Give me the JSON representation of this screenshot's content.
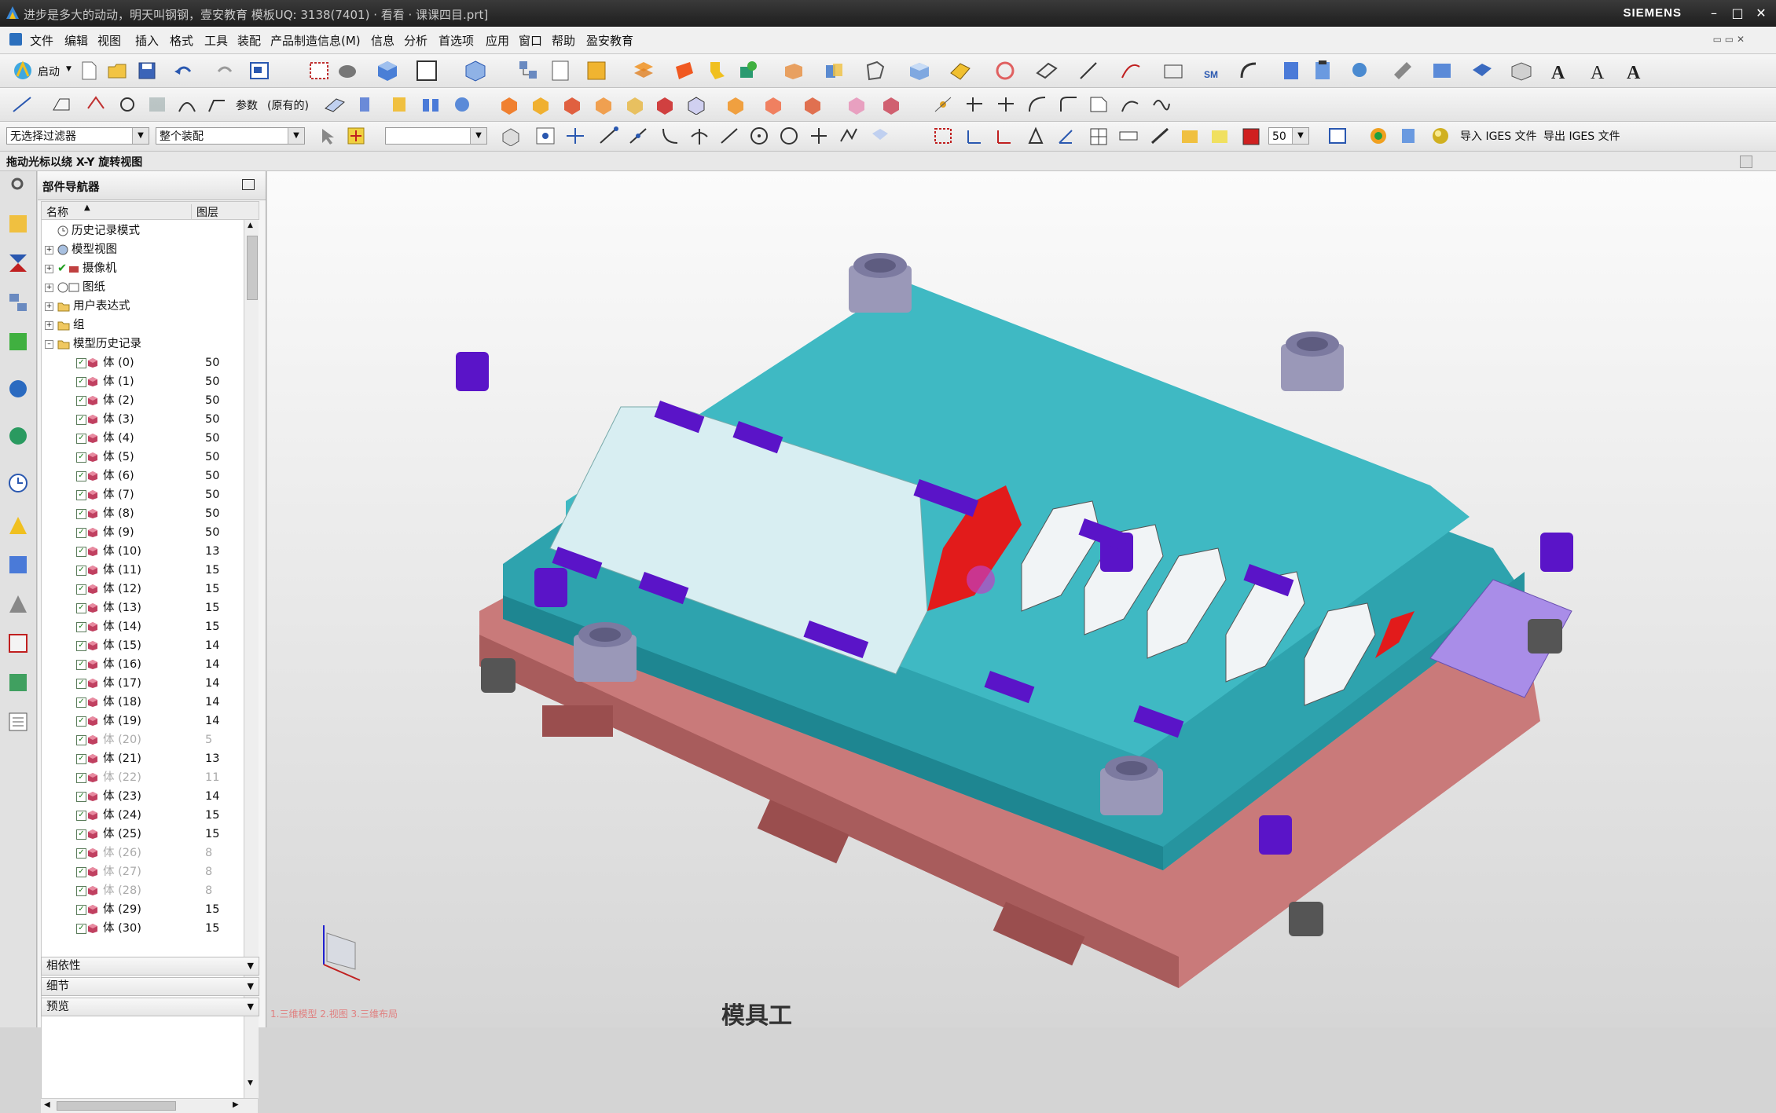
{
  "window": {
    "title": "进步是多大的动动，明天叫钢钢，壹安教育 模板UQ: 3138(7401) · 看看 · 课课四目.prt]",
    "brand": "SIEMENS"
  },
  "menu": [
    "文件",
    "编辑",
    "视图",
    "插入",
    "格式",
    "工具",
    "装配",
    "产品制造信息(M)",
    "信息",
    "分析",
    "首选项",
    "应用",
    "窗口",
    "帮助",
    "盈安教育"
  ],
  "toolbar": {
    "start_label": "启动",
    "param_label": "参数",
    "param_mode": "(原有的)",
    "filter_select": "无选择过滤器",
    "assembly_select": "整个装配",
    "zoom_value": "50",
    "import_iges": "导入 IGES 文件",
    "export_iges": "导出 IGES 文件"
  },
  "status_text": "拖动光标以绕 X-Y 旋转视图",
  "navigator": {
    "title": "部件导航器",
    "col_name": "名称",
    "col_layer": "图层",
    "top_items": [
      {
        "label": "历史记录模式",
        "icon": "clock-icon",
        "expand": false
      },
      {
        "label": "模型视图",
        "icon": "model-views-icon",
        "expand": true
      },
      {
        "label": "摄像机",
        "icon": "camera-icon",
        "expand": true
      },
      {
        "label": "图纸",
        "icon": "drawing-icon",
        "expand": true
      },
      {
        "label": "用户表达式",
        "icon": "folder-icon",
        "expand": true
      },
      {
        "label": "组",
        "icon": "folder-icon",
        "expand": true
      },
      {
        "label": "模型历史记录",
        "icon": "folder-open-icon",
        "expand": true
      }
    ],
    "bodies": [
      {
        "name": "体 (0)",
        "layer": "50",
        "dim": false
      },
      {
        "name": "体 (1)",
        "layer": "50",
        "dim": false
      },
      {
        "name": "体 (2)",
        "layer": "50",
        "dim": false
      },
      {
        "name": "体 (3)",
        "layer": "50",
        "dim": false
      },
      {
        "name": "体 (4)",
        "layer": "50",
        "dim": false
      },
      {
        "name": "体 (5)",
        "layer": "50",
        "dim": false
      },
      {
        "name": "体 (6)",
        "layer": "50",
        "dim": false
      },
      {
        "name": "体 (7)",
        "layer": "50",
        "dim": false
      },
      {
        "name": "体 (8)",
        "layer": "50",
        "dim": false
      },
      {
        "name": "体 (9)",
        "layer": "50",
        "dim": false
      },
      {
        "name": "体 (10)",
        "layer": "13",
        "dim": false
      },
      {
        "name": "体 (11)",
        "layer": "15",
        "dim": false
      },
      {
        "name": "体 (12)",
        "layer": "15",
        "dim": false
      },
      {
        "name": "体 (13)",
        "layer": "15",
        "dim": false
      },
      {
        "name": "体 (14)",
        "layer": "15",
        "dim": false
      },
      {
        "name": "体 (15)",
        "layer": "14",
        "dim": false
      },
      {
        "name": "体 (16)",
        "layer": "14",
        "dim": false
      },
      {
        "name": "体 (17)",
        "layer": "14",
        "dim": false
      },
      {
        "name": "体 (18)",
        "layer": "14",
        "dim": false
      },
      {
        "name": "体 (19)",
        "layer": "14",
        "dim": false
      },
      {
        "name": "体 (20)",
        "layer": "5",
        "dim": true
      },
      {
        "name": "体 (21)",
        "layer": "13",
        "dim": false
      },
      {
        "name": "体 (22)",
        "layer": "11",
        "dim": true
      },
      {
        "name": "体 (23)",
        "layer": "14",
        "dim": false
      },
      {
        "name": "体 (24)",
        "layer": "15",
        "dim": false
      },
      {
        "name": "体 (25)",
        "layer": "15",
        "dim": false
      },
      {
        "name": "体 (26)",
        "layer": "8",
        "dim": true
      },
      {
        "name": "体 (27)",
        "layer": "8",
        "dim": true
      },
      {
        "name": "体 (28)",
        "layer": "8",
        "dim": true
      },
      {
        "name": "体 (29)",
        "layer": "15",
        "dim": false
      },
      {
        "name": "体 (30)",
        "layer": "15",
        "dim": false
      }
    ],
    "panels": [
      "相依性",
      "细节",
      "预览"
    ]
  },
  "viewport": {
    "hint_text": "1.三维模型  2.视图  3.三维布局",
    "watermark": "模具工"
  },
  "colors": {
    "die_plate": "#31a9b4",
    "die_base": "#c77272",
    "guide_post": "#8d8aa3",
    "purple_block": "#5a14c8",
    "strip_part": "#d6ecf0",
    "red_part": "#e01818"
  }
}
